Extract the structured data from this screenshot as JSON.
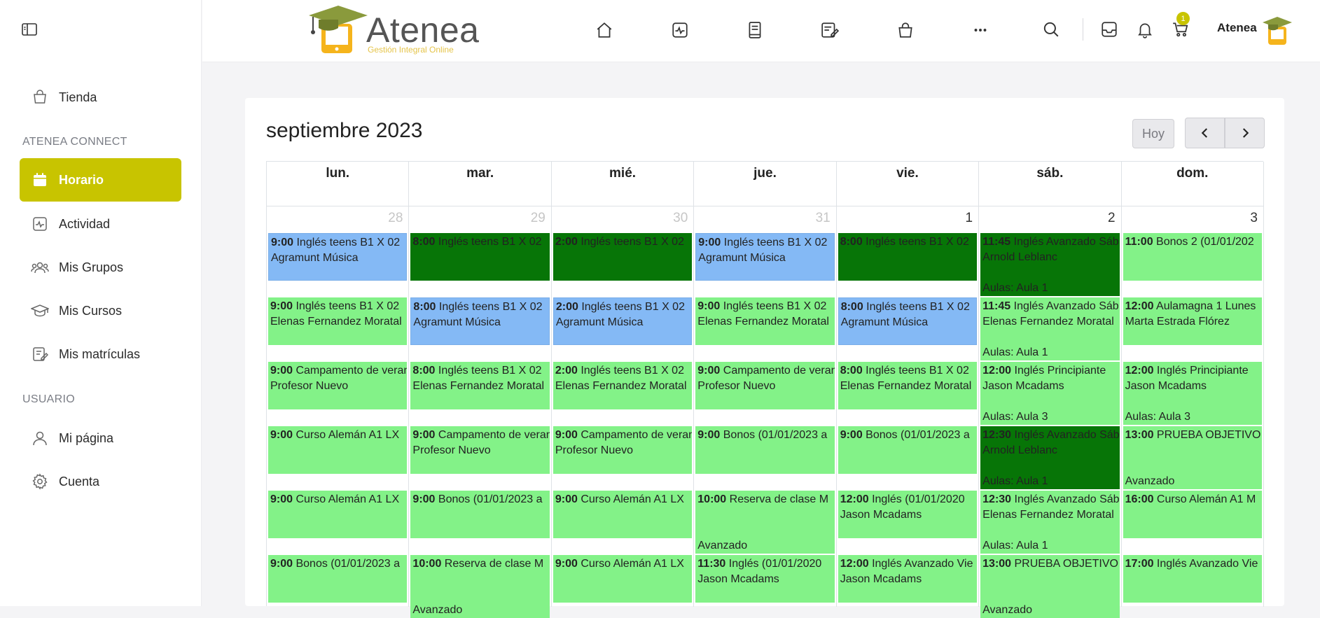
{
  "sidebar": {
    "items": [
      {
        "label": "Tienda",
        "icon": "bag-icon"
      },
      {
        "label": "Horario",
        "icon": "calendar-icon"
      },
      {
        "label": "Actividad",
        "icon": "activity-icon"
      },
      {
        "label": "Mis Grupos",
        "icon": "users-icon"
      },
      {
        "label": "Mis Cursos",
        "icon": "graduation-cap-icon"
      },
      {
        "label": "Mis matrículas",
        "icon": "enrollment-icon"
      },
      {
        "label": "Mi página",
        "icon": "user-icon"
      },
      {
        "label": "Cuenta",
        "icon": "gear-icon"
      }
    ],
    "sections": {
      "connect": "ATENEA CONNECT",
      "user": "USUARIO"
    },
    "active_color": "#c8c400"
  },
  "header": {
    "logo_title": "Atenea",
    "logo_subtitle": "Gestión Integral Online",
    "cart_badge": "1",
    "user_name": "Atenea"
  },
  "calendar": {
    "title": "septiembre 2023",
    "today_label": "Hoy",
    "weekdays": [
      "lun.",
      "mar.",
      "mié.",
      "jue.",
      "vie.",
      "sáb.",
      "dom."
    ],
    "days": [
      {
        "num": "28",
        "other": true,
        "events": [
          {
            "color": "blue",
            "time": "9:00",
            "title": " Inglés teens B1 X 02",
            "line2": "Agramunt Música",
            "line3": ""
          },
          {
            "color": "green",
            "time": "9:00",
            "title": " Inglés teens B1 X 02",
            "line2": "Elenas Fernandez Moratal",
            "line3": ""
          },
          {
            "color": "green",
            "time": "9:00",
            "title": " Campamento de verano",
            "line2": "Profesor Nuevo",
            "line3": ""
          },
          {
            "color": "green",
            "time": "9:00",
            "title": " Curso Alemán A1 LX",
            "line2": "",
            "line3": ""
          },
          {
            "color": "green",
            "time": "9:00",
            "title": " Curso Alemán A1 LX",
            "line2": "",
            "line3": ""
          },
          {
            "color": "green",
            "time": "9:00",
            "title": " Bonos (01/01/2023 a",
            "line2": "",
            "line3": ""
          }
        ]
      },
      {
        "num": "29",
        "other": true,
        "events": [
          {
            "color": "dark",
            "time": "8:00",
            "title": " Inglés teens B1 X 02",
            "line2": "",
            "line3": ""
          },
          {
            "color": "blue",
            "time": "8:00",
            "title": " Inglés teens B1 X 02",
            "line2": "Agramunt Música",
            "line3": ""
          },
          {
            "color": "green",
            "time": "8:00",
            "title": " Inglés teens B1 X 02",
            "line2": "Elenas Fernandez Moratal",
            "line3": ""
          },
          {
            "color": "green",
            "time": "9:00",
            "title": " Campamento de verano",
            "line2": "Profesor Nuevo",
            "line3": ""
          },
          {
            "color": "green",
            "time": "9:00",
            "title": " Bonos (01/01/2023 a",
            "line2": "",
            "line3": ""
          },
          {
            "color": "green",
            "time": "10:00",
            "title": " Reserva de clase M",
            "line2": "",
            "line3": "Avanzado"
          }
        ]
      },
      {
        "num": "30",
        "other": true,
        "events": [
          {
            "color": "dark",
            "time": "2:00",
            "title": " Inglés teens B1 X 02",
            "line2": "",
            "line3": ""
          },
          {
            "color": "blue",
            "time": "2:00",
            "title": " Inglés teens B1 X 02",
            "line2": "Agramunt Música",
            "line3": ""
          },
          {
            "color": "green",
            "time": "2:00",
            "title": " Inglés teens B1 X 02",
            "line2": "Elenas Fernandez Moratal",
            "line3": ""
          },
          {
            "color": "green",
            "time": "9:00",
            "title": " Campamento de verano",
            "line2": "Profesor Nuevo",
            "line3": ""
          },
          {
            "color": "green",
            "time": "9:00",
            "title": " Curso Alemán A1 LX",
            "line2": "",
            "line3": ""
          },
          {
            "color": "green",
            "time": "9:00",
            "title": " Curso Alemán A1 LX",
            "line2": "",
            "line3": ""
          }
        ]
      },
      {
        "num": "31",
        "other": true,
        "events": [
          {
            "color": "blue",
            "time": "9:00",
            "title": " Inglés teens B1 X 02",
            "line2": "Agramunt Música",
            "line3": ""
          },
          {
            "color": "green",
            "time": "9:00",
            "title": " Inglés teens B1 X 02",
            "line2": "Elenas Fernandez Moratal",
            "line3": ""
          },
          {
            "color": "green",
            "time": "9:00",
            "title": " Campamento de verano",
            "line2": "Profesor Nuevo",
            "line3": ""
          },
          {
            "color": "green",
            "time": "9:00",
            "title": " Bonos (01/01/2023 a",
            "line2": "",
            "line3": ""
          },
          {
            "color": "green",
            "time": "10:00",
            "title": " Reserva de clase M",
            "line2": "",
            "line3": "Avanzado"
          },
          {
            "color": "green",
            "time": "11:30",
            "title": " Inglés (01/01/2020",
            "line2": "Jason Mcadams",
            "line3": ""
          }
        ]
      },
      {
        "num": "1",
        "other": false,
        "events": [
          {
            "color": "dark",
            "time": "8:00",
            "title": " Inglés teens B1 X 02",
            "line2": "",
            "line3": ""
          },
          {
            "color": "blue",
            "time": "8:00",
            "title": " Inglés teens B1 X 02",
            "line2": "Agramunt Música",
            "line3": ""
          },
          {
            "color": "green",
            "time": "8:00",
            "title": " Inglés teens B1 X 02",
            "line2": "Elenas Fernandez Moratal",
            "line3": ""
          },
          {
            "color": "green",
            "time": "9:00",
            "title": " Bonos (01/01/2023 a",
            "line2": "",
            "line3": ""
          },
          {
            "color": "green",
            "time": "12:00",
            "title": " Inglés (01/01/2020",
            "line2": "Jason Mcadams",
            "line3": ""
          },
          {
            "color": "green",
            "time": "12:00",
            "title": " Inglés Avanzado Vie",
            "line2": "Jason Mcadams",
            "line3": ""
          }
        ]
      },
      {
        "num": "2",
        "other": false,
        "events": [
          {
            "color": "dark",
            "time": "11:45",
            "title": " Inglés Avanzado Sáb",
            "line2": "Arnold Leblanc",
            "line3": "Aulas: Aula 1"
          },
          {
            "color": "green",
            "time": "11:45",
            "title": " Inglés Avanzado Sáb",
            "line2": "Elenas Fernandez Moratal",
            "line3": "Aulas: Aula 1"
          },
          {
            "color": "green",
            "time": "12:00",
            "title": " Inglés Principiante",
            "line2": "Jason Mcadams",
            "line3": "Aulas: Aula 3"
          },
          {
            "color": "dark",
            "time": "12:30",
            "title": " Inglés Avanzado Sáb",
            "line2": "Arnold Leblanc",
            "line3": "Aulas: Aula 1"
          },
          {
            "color": "green",
            "time": "12:30",
            "title": " Inglés Avanzado Sáb",
            "line2": "Elenas Fernandez Moratal",
            "line3": "Aulas: Aula 1"
          },
          {
            "color": "green",
            "time": "13:00",
            "title": " PRUEBA OBJETIVO",
            "line2": "",
            "line3": "Avanzado"
          }
        ]
      },
      {
        "num": "3",
        "other": false,
        "events": [
          {
            "color": "green",
            "time": "11:00",
            "title": " Bonos 2 (01/01/202",
            "line2": "",
            "line3": ""
          },
          {
            "color": "green",
            "time": "12:00",
            "title": " Aulamagna 1 Lunes",
            "line2": "Marta Estrada Flórez",
            "line3": ""
          },
          {
            "color": "green",
            "time": "12:00",
            "title": " Inglés Principiante",
            "line2": "Jason Mcadams",
            "line3": "Aulas: Aula 3"
          },
          {
            "color": "green",
            "time": "13:00",
            "title": " PRUEBA OBJETIVO",
            "line2": "",
            "line3": "Avanzado"
          },
          {
            "color": "green",
            "time": "16:00",
            "title": " Curso Alemán A1 M",
            "line2": "",
            "line3": ""
          },
          {
            "color": "green",
            "time": "17:00",
            "title": " Inglés Avanzado Vie",
            "line2": "",
            "line3": ""
          }
        ]
      }
    ]
  },
  "colors": {
    "green": "#83f288",
    "blue": "#84b9f5",
    "dark": "#077507",
    "accent": "#c8c400"
  }
}
